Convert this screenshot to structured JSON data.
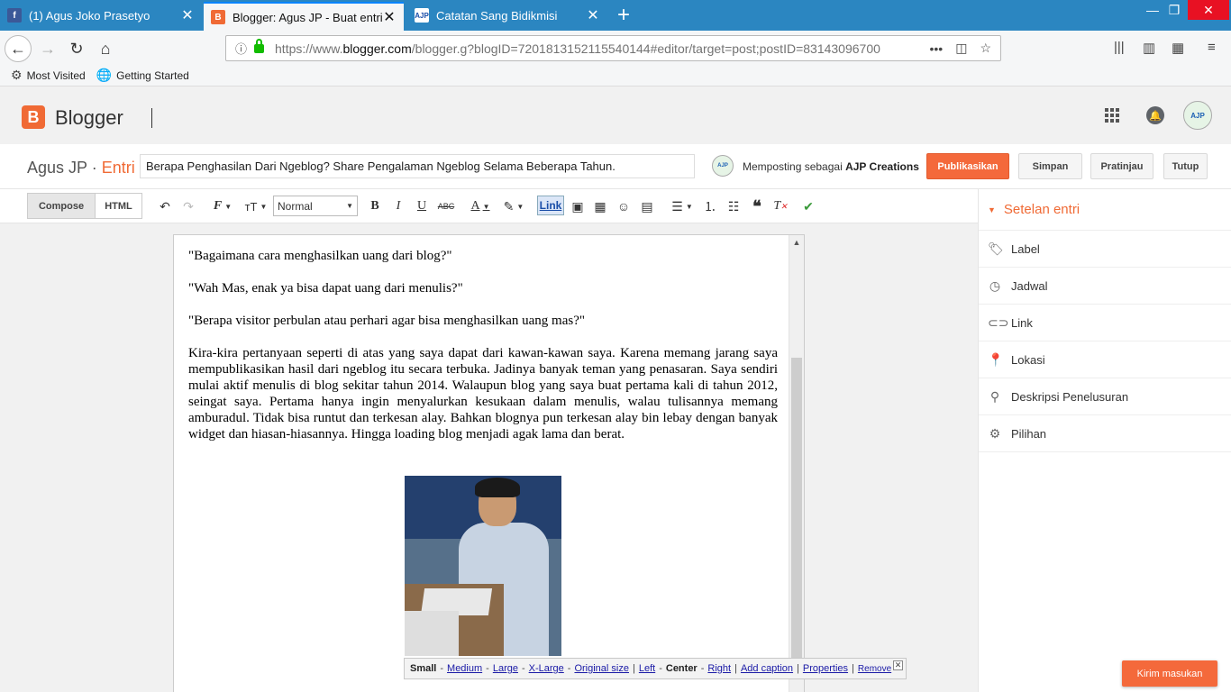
{
  "browser": {
    "tabs": [
      {
        "title": "(1) Agus Joko Prasetyo",
        "favicon": "facebook-icon",
        "active": false
      },
      {
        "title": "Blogger: Agus JP - Buat entri",
        "favicon": "blogger-icon",
        "active": true
      },
      {
        "title": "Catatan Sang Bidikmisi",
        "favicon": "AJP",
        "active": false
      }
    ],
    "url_prefix": "https://www.",
    "url_domain": "blogger.com",
    "url_rest": "/blogger.g?blogID=7201813152115540144#editor/target=post;postID=83143096700",
    "bookmarks": [
      "Most Visited",
      "Getting Started"
    ]
  },
  "blogger": {
    "app_name": "Blogger",
    "logo_letter": "B",
    "avatar_text": "AJP"
  },
  "post": {
    "blog_name": "Agus JP",
    "separator": "·",
    "section": "Entri",
    "title": "Berapa Penghasilan Dari Ngeblog? Share Pengalaman Ngeblog Selama Beberapa Tahun.",
    "author_prefix": "Memposting sebagai",
    "author_name": "AJP Creations",
    "buttons": {
      "publish": "Publikasikan",
      "save": "Simpan",
      "preview": "Pratinjau",
      "close": "Tutup"
    }
  },
  "toolbar": {
    "compose": "Compose",
    "html": "HTML",
    "format": "Normal",
    "link": "Link"
  },
  "editor": {
    "q1": "\"Bagaimana cara menghasilkan uang dari blog?\"",
    "q2": "\"Wah Mas, enak ya bisa dapat uang dari menulis?\"",
    "q3": "\"Berapa  visitor perbulan atau perhari agar bisa menghasilkan uang mas?\"",
    "para1": "Kira-kira pertanyaan seperti di atas yang saya dapat dari kawan-kawan saya. Karena memang jarang saya mempublikasikan hasil dari ngeblog itu secara terbuka. Jadinya banyak teman yang penasaran. Saya sendiri mulai aktif menulis di blog sekitar tahun 2014. Walaupun blog yang saya buat pertama kali di tahun 2012, seingat saya. Pertama hanya ingin menyalurkan kesukaan dalam menulis, walau tulisannya memang amburadul. Tidak bisa runtut dan terkesan alay. Bahkan blognya pun terkesan alay bin lebay dengan banyak widget dan hiasan-hiasannya. Hingga loading blog menjadi agak lama dan berat."
  },
  "image_bar": {
    "small": "Small",
    "medium": "Medium",
    "large": "Large",
    "xlarge": "X-Large",
    "original": "Original size",
    "left": "Left",
    "center": "Center",
    "right": "Right",
    "caption": "Add caption",
    "properties": "Properties",
    "remove": "Remove"
  },
  "sidebar": {
    "header": "Setelan entri",
    "items": [
      {
        "label": "Label",
        "icon": "tag-icon"
      },
      {
        "label": "Jadwal",
        "icon": "clock-icon"
      },
      {
        "label": "Link",
        "icon": "link-icon"
      },
      {
        "label": "Lokasi",
        "icon": "location-pin-icon"
      },
      {
        "label": "Deskripsi Penelusuran",
        "icon": "search-icon"
      },
      {
        "label": "Pilihan",
        "icon": "gear-icon"
      }
    ]
  },
  "feedback": "Kirim masukan",
  "colors": {
    "accent": "#f06a35",
    "tabbar": "#2b86c1",
    "publish": "#f4693b"
  }
}
